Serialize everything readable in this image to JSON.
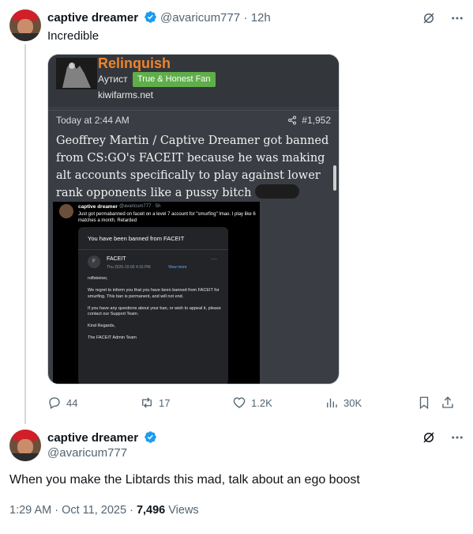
{
  "quoted_post": {
    "author_name": "captive dreamer",
    "author_handle": "@avaricum777",
    "time": "12h",
    "text": "Incredible",
    "image": {
      "forum_name": "Relinquish",
      "forum_rank": "Аутист",
      "forum_badge": "True & Honest Fan",
      "site": "kiwifarms.net",
      "timestamp": "Today at 2:44 AM",
      "post_number": "#1,952",
      "post_text": "Geoffrey Martin / Captive Dreamer got banned from CS:GO's FACEIT because he was making alt accounts specifically to play against lower rank opponents like a pussy bitch",
      "screenshot": {
        "name": "captive dreamer",
        "handle": "@avaricum777 · 5h",
        "text": "Just got permabanned on faceit on a level 7 account for \"smurfing\" lmao. I play like 6 matches a month. Retarded",
        "email_title": "You have been banned from FACEIT",
        "email_logo": "F",
        "email_from": "FACEIT",
        "email_date": "Thu 2025-10-09 4:16 PM",
        "email_view": "View more",
        "email_body": "rolfsteiner,\n\nWe regret to inform you that you have been banned from FACEIT for smurfing. This ban is permanent, and will not end.\n\nIf you have any questions about your ban, or wish to appeal it, please contact our Support Team.\n\nKind Regards,\n\nThe FACEIT Admin Team"
      }
    },
    "actions": {
      "replies": "44",
      "reposts": "17",
      "likes": "1.2K",
      "views": "30K"
    }
  },
  "main_post": {
    "author_name": "captive dreamer",
    "author_handle": "@avaricum777",
    "text": "When you make the Libtards this mad, talk about an ego boost",
    "time": "1:29 AM · Oct 11, 2025 · ",
    "views_count": "7,496",
    "views_label": " Views"
  },
  "colors": {
    "accent": "#1d9bf0",
    "forum_name": "#f0832a",
    "badge": "#5fae4a",
    "secondary_text": "#536471"
  }
}
